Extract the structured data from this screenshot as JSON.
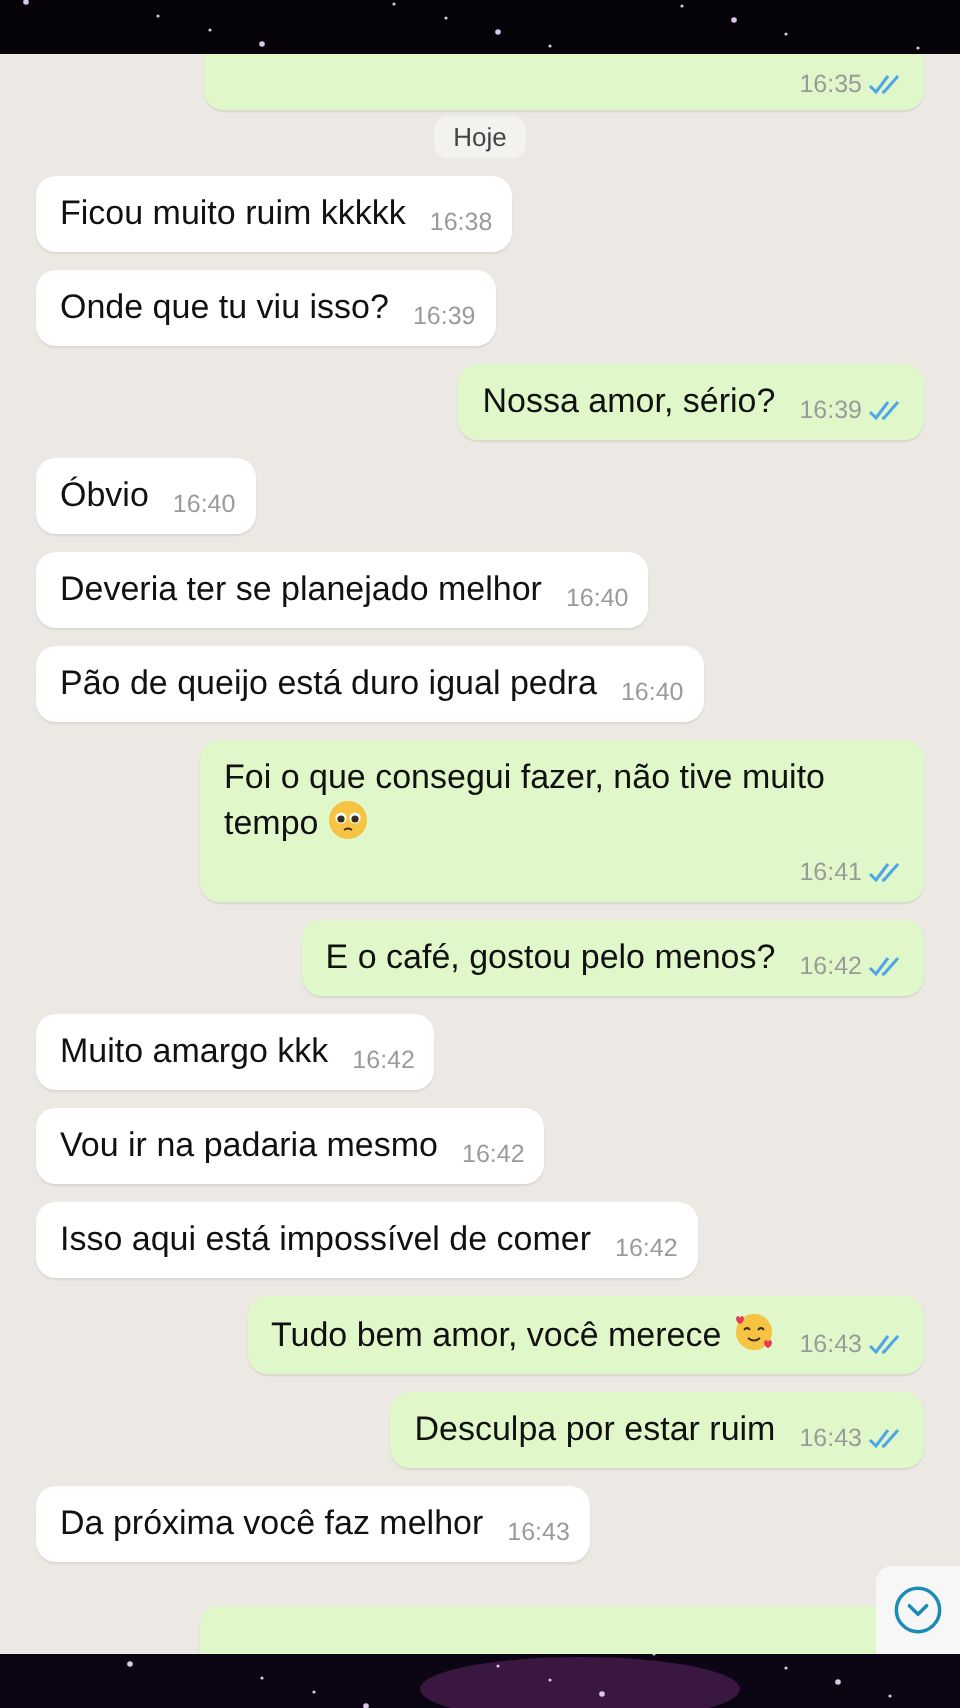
{
  "messages": [
    {
      "kind": "message",
      "outgoing": true,
      "time": "16:35",
      "read": true
    },
    {
      "kind": "date",
      "text": "Hoje"
    },
    {
      "kind": "message",
      "outgoing": false,
      "text": "Ficou muito ruim kkkkk",
      "time": "16:38"
    },
    {
      "kind": "message",
      "outgoing": false,
      "text": "Onde que tu viu isso?",
      "time": "16:39"
    },
    {
      "kind": "message",
      "outgoing": true,
      "text": "Nossa amor, sério?",
      "time": "16:39",
      "read": true
    },
    {
      "kind": "message",
      "outgoing": false,
      "text": "Óbvio",
      "time": "16:40"
    },
    {
      "kind": "message",
      "outgoing": false,
      "text": "Deveria ter se planejado melhor",
      "time": "16:40"
    },
    {
      "kind": "message",
      "outgoing": false,
      "text": "Pão de queijo está duro igual pedra",
      "time": "16:40"
    },
    {
      "kind": "message",
      "outgoing": true,
      "text": "Foi o que consegui fazer, não tive muito tempo",
      "emoji": {
        "kind": "pleading"
      },
      "time": "16:41",
      "read": true
    },
    {
      "kind": "message",
      "outgoing": true,
      "text": "E o café, gostou pelo menos?",
      "time": "16:42",
      "read": true
    },
    {
      "kind": "message",
      "outgoing": false,
      "text": "Muito amargo kkk",
      "time": "16:42"
    },
    {
      "kind": "message",
      "outgoing": false,
      "text": "Vou ir na padaria mesmo",
      "time": "16:42"
    },
    {
      "kind": "message",
      "outgoing": false,
      "text": "Isso aqui está impossível de comer",
      "time": "16:42"
    },
    {
      "kind": "message",
      "outgoing": true,
      "text": "Tudo bem amor, você merece",
      "emoji": {
        "kind": "hearts"
      },
      "time": "16:43",
      "read": true
    },
    {
      "kind": "message",
      "outgoing": true,
      "text": "Desculpa por estar ruim",
      "time": "16:43",
      "read": true
    },
    {
      "kind": "message",
      "outgoing": false,
      "text": "Da próxima você faz melhor",
      "time": "16:43"
    },
    {
      "kind": "partial",
      "outgoing": true
    }
  ]
}
